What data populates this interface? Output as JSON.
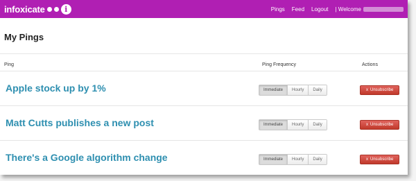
{
  "brand": {
    "name": "infoxicate",
    "info_icon": "i"
  },
  "nav": {
    "items": [
      "Pings",
      "Feed",
      "Logout"
    ],
    "welcome_label": "| Welcome"
  },
  "page": {
    "title": "My Pings"
  },
  "table": {
    "headers": {
      "ping": "Ping",
      "frequency": "Ping Frequency",
      "actions": "Actions"
    },
    "rows": [
      {
        "ping": "Apple stock up by 1%",
        "selected_frequency": "Immediate"
      },
      {
        "ping": "Matt Cutts publishes a new post",
        "selected_frequency": "Immediate"
      },
      {
        "ping": "There's a Google algorithm change",
        "selected_frequency": "Immediate"
      }
    ],
    "frequency_options": [
      "Immediate",
      "Hourly",
      "Daily"
    ],
    "action_label": "Unsubscribe",
    "action_icon": "x"
  },
  "colors": {
    "navbar": "#b01fb3",
    "ping_text": "#2e8fb0",
    "unsubscribe_button": "#c0392b"
  }
}
